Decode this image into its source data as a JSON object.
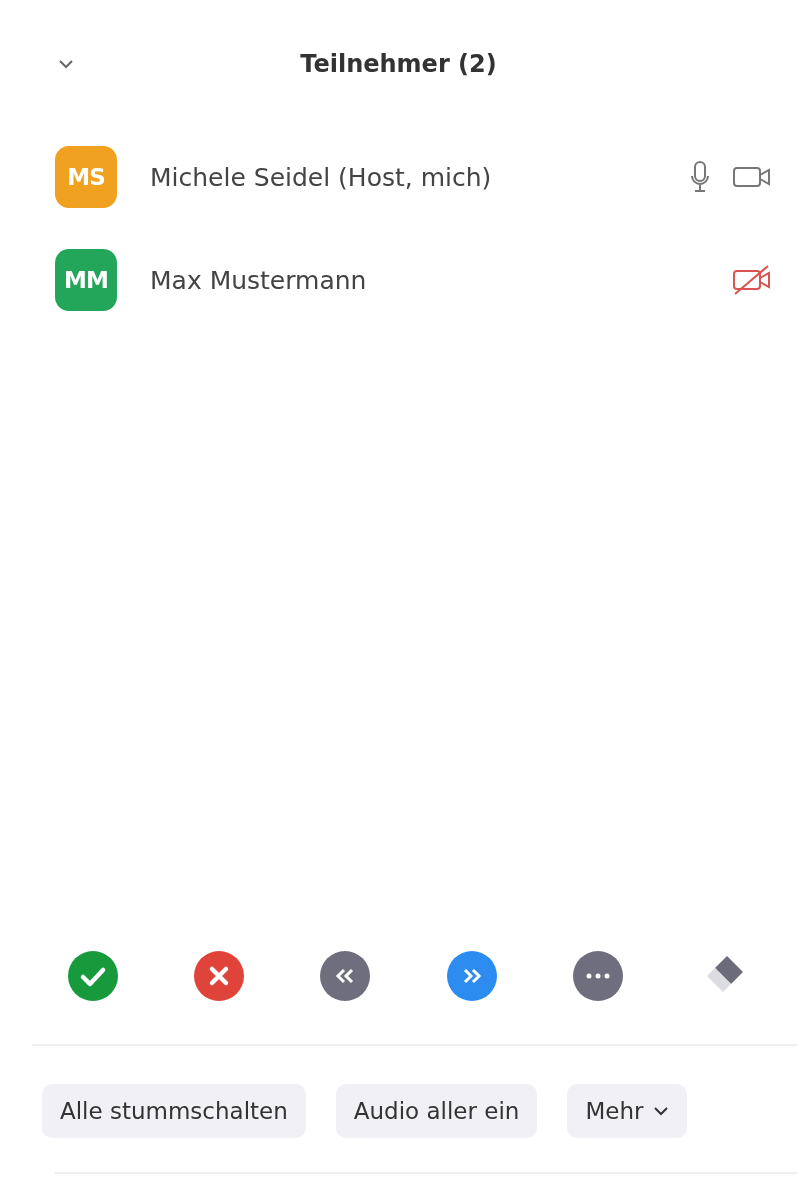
{
  "header": {
    "title": "Teilnehmer (2)"
  },
  "participants": [
    {
      "initials": "MS",
      "name": "Michele Seidel (Host, mich)",
      "color": "#f0a11f",
      "mic_shown": true,
      "video_on": true
    },
    {
      "initials": "MM",
      "name": "Max Mustermann",
      "color": "#23a55a",
      "mic_shown": false,
      "video_on": false
    }
  ],
  "reactions": [
    {
      "kind": "yes"
    },
    {
      "kind": "no"
    },
    {
      "kind": "slower"
    },
    {
      "kind": "faster"
    },
    {
      "kind": "more"
    },
    {
      "kind": "clear"
    }
  ],
  "buttons": [
    {
      "label": "Alle stummschalten",
      "dropdown": false
    },
    {
      "label": "Audio aller ein",
      "dropdown": false
    },
    {
      "label": "Mehr",
      "dropdown": true
    }
  ]
}
